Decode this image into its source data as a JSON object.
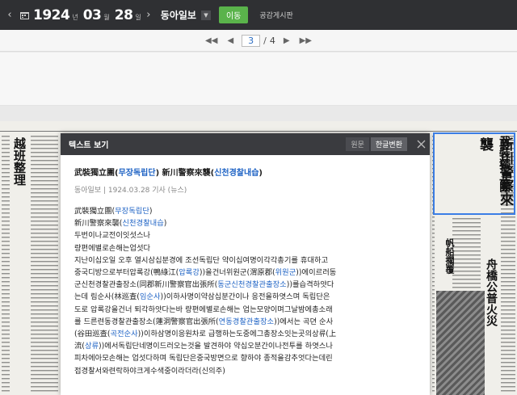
{
  "topbar": {
    "year": "1924",
    "year_unit": "년",
    "month": "03",
    "month_unit": "월",
    "day": "28",
    "day_unit": "일",
    "newspaper": "동아일보",
    "go_label": "이동",
    "board_label": "공감게시판"
  },
  "pager": {
    "current": "3",
    "separator": "/",
    "total": "4"
  },
  "panel": {
    "title": "텍스트 보기",
    "original_label": "원문",
    "convert_label": "한글변환",
    "headline_a": "武裝獨立團(",
    "headline_a_ko": "무장독립단",
    "headline_b": ") 新川警察來襲(",
    "headline_b_ko": "신천경찰내습",
    "headline_c": ")",
    "meta": "동아일보 | 1924.03.28 기사 (뉴스)",
    "lines": [
      [
        "武裝獨立團(",
        "무장독립단",
        ")"
      ],
      [
        "新川警察來襲(",
        "신천경찰내습",
        ")"
      ],
      [
        "두번이나교전이잇섯스나"
      ],
      [
        "량편에별로손해는업섯다"
      ],
      [
        "지난이십오일 오후 열시삼십분경에 조선독립단 약이십여명이각각총기를 휴대하고"
      ],
      [
        "중국디방으로부터압록강(鴨綠江(",
        "압록강",
        "))을건너위원군(渭原郡(",
        "위원군",
        "))에이르러동"
      ],
      [
        "군신천경찰관출장소(同郡新川警察官出張所(",
        "동군신천경찰관출장소",
        "))를습격하얏다"
      ],
      [
        "는데 림순사(林巡査(",
        "임순사",
        "))이하사명이약삼십분간이나 응전을하엿스며 독립단은"
      ],
      [
        "도로 압록강을건너 퇴각하얏다는바 량편에별로손해는 업는모양이며그날밤에총소래"
      ],
      [
        "를 드른련동경찰관출장소(蓮洞警察官出張所(",
        "연동경찰관출장소",
        "))에서는 곡뎐 순사"
      ],
      [
        "(谷田巡査(",
        "곡전순사",
        "))이하삼명이응원차로 급행하는도중에그총장소잇는곳의상류(上"
      ],
      [
        "流(",
        "상류",
        "))에서독립단네명이드러오는것을 발견하야 약십오분간이나전투를 하엿스나"
      ],
      [
        "피차에아모손해는 업섯다하며 독립단은중국방면으로 향하야 종적을감추엇다는데린"
      ],
      [
        "접경찰서와련락하야크게수색중이라더라(신의주)"
      ]
    ]
  },
  "newspaper_bg": {
    "left_headline": "越班整理",
    "right_headline_a": "武裝獨立團",
    "right_headline_b": "新川警察來襲",
    "right_headline_c": "舟橋公普火災",
    "right_small": "帆船擱覆"
  }
}
